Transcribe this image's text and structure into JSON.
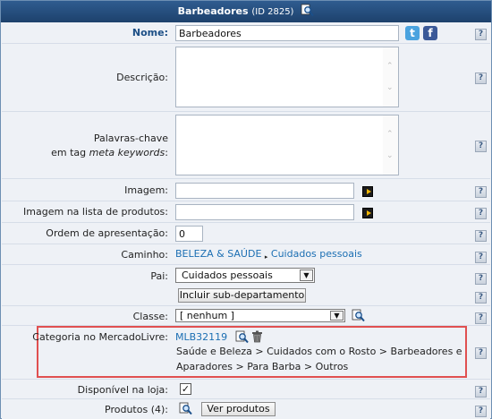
{
  "header": {
    "title": "Barbeadores",
    "id_text": "(ID 2825)"
  },
  "fields": {
    "nome": {
      "label": "Nome:",
      "value": "Barbeadores"
    },
    "descricao": {
      "label": "Descrição:"
    },
    "palavras": {
      "label_line1": "Palavras-chave",
      "label_line2_prefix": "em tag ",
      "label_line2_em": "meta keywords",
      "label_line2_suffix": ":"
    },
    "imagem": {
      "label": "Imagem:",
      "value": ""
    },
    "imagem_lista": {
      "label": "Imagem na lista de produtos:",
      "value": ""
    },
    "ordem": {
      "label": "Ordem de apresentação:",
      "value": "0"
    },
    "caminho": {
      "label": "Caminho:",
      "part1": "BELEZA & SAÚDE",
      "part2": "Cuidados pessoais"
    },
    "pai": {
      "label": "Pai:",
      "selected": "Cuidados pessoais"
    },
    "incluir": {
      "button": "Incluir sub-departamento"
    },
    "classe": {
      "label": "Classe:",
      "selected": "[ nenhum ]"
    },
    "categoria": {
      "label": "Categoria no MercadoLivre:",
      "code": "MLB32119",
      "path_line1": "Saúde e Beleza > Cuidados com o Rosto > Barbeadores e",
      "path_line2": "Aparadores > Para Barba > Outros"
    },
    "disponivel": {
      "label": "Disponível na loja:",
      "checked": "✓"
    },
    "produtos": {
      "label": "Produtos (4):",
      "button": "Ver produtos"
    }
  },
  "help_symbol": "?",
  "social": {
    "twitter": "t",
    "facebook": "f"
  },
  "colors": {
    "header": "#2f5c90",
    "link": "#1c6fb3",
    "highlight_box": "#e05050"
  }
}
